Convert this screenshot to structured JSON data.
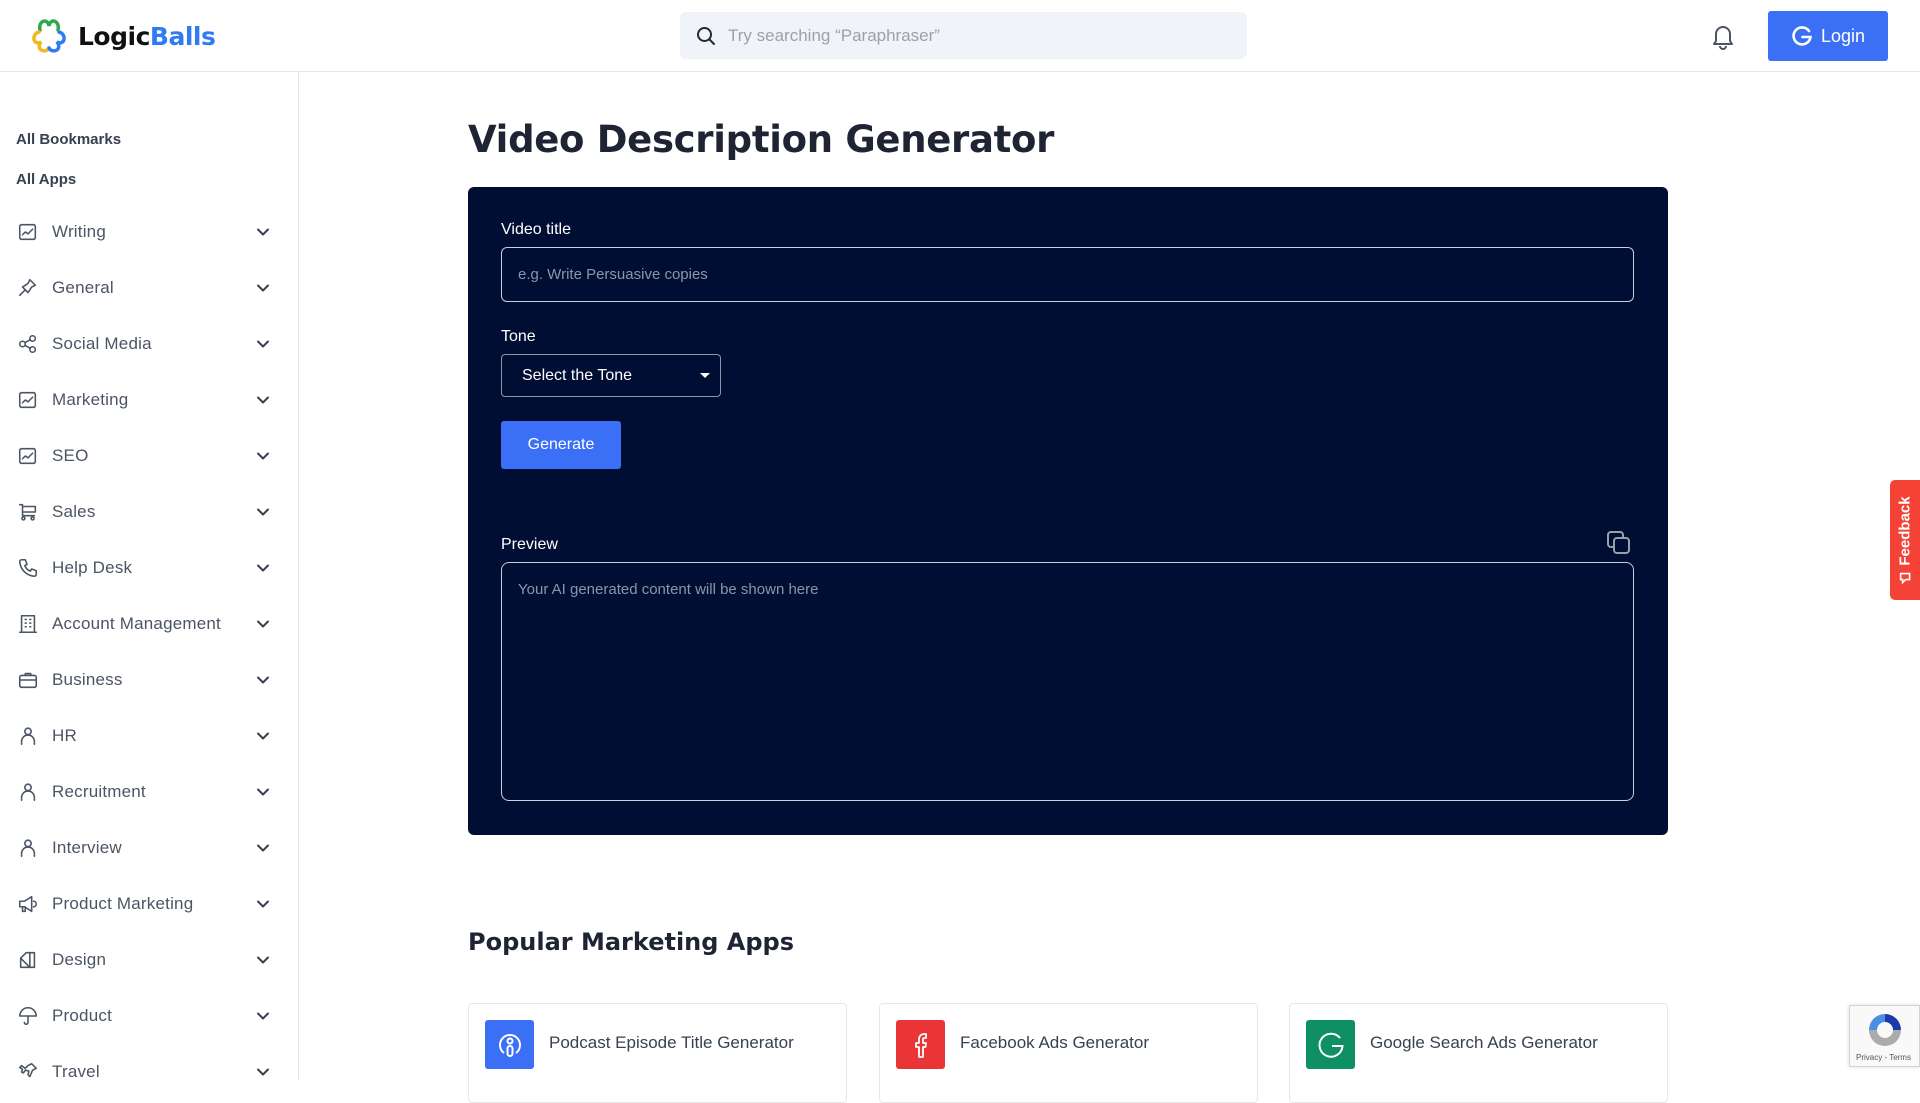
{
  "header": {
    "logo": {
      "part1": "Logic",
      "part2": "Balls",
      "icon": "logicballs-logo-icon"
    },
    "search": {
      "placeholder": "Try searching “Paraphraser”",
      "value": "",
      "icon": "search-icon"
    },
    "notifications_icon": "bell-icon",
    "login": {
      "label": "Login",
      "icon": "google-g-icon"
    }
  },
  "sidebar": {
    "headings": [
      "All Bookmarks",
      "All Apps"
    ],
    "items": [
      {
        "label": "Writing",
        "icon": "chart-box-icon"
      },
      {
        "label": "General",
        "icon": "pin-icon"
      },
      {
        "label": "Social Media",
        "icon": "share-icon"
      },
      {
        "label": "Marketing",
        "icon": "chart-box-icon"
      },
      {
        "label": "SEO",
        "icon": "chart-box-icon"
      },
      {
        "label": "Sales",
        "icon": "cart-icon"
      },
      {
        "label": "Help Desk",
        "icon": "phone-icon"
      },
      {
        "label": "Account Management",
        "icon": "building-icon"
      },
      {
        "label": "Business",
        "icon": "briefcase-icon"
      },
      {
        "label": "HR",
        "icon": "user-icon"
      },
      {
        "label": "Recruitment",
        "icon": "user-icon"
      },
      {
        "label": "Interview",
        "icon": "user-icon"
      },
      {
        "label": "Product Marketing",
        "icon": "megaphone-icon"
      },
      {
        "label": "Design",
        "icon": "design-icon"
      },
      {
        "label": "Product",
        "icon": "umbrella-icon"
      },
      {
        "label": "Travel",
        "icon": "plane-icon"
      }
    ]
  },
  "main": {
    "title": "Video Description Generator",
    "form": {
      "video_title": {
        "label": "Video title",
        "placeholder": "e.g. Write Persuasive copies",
        "value": ""
      },
      "tone": {
        "label": "Tone",
        "selected": "Select the Tone"
      },
      "generate_label": "Generate",
      "preview": {
        "label": "Preview",
        "placeholder": "Your AI generated content will be shown here",
        "copy_icon": "copy-icon"
      }
    },
    "popular": {
      "title": "Popular Marketing Apps",
      "apps": [
        {
          "name": "Podcast Episode Title Generator",
          "icon": "podcast-icon",
          "color": "#3b6ff5"
        },
        {
          "name": "Facebook Ads Generator",
          "icon": "facebook-icon",
          "color": "#ea3536"
        },
        {
          "name": "Google Search Ads Generator",
          "icon": "google-g-icon",
          "color": "#0e8f64"
        }
      ]
    }
  },
  "feedback": {
    "label": "Feedback"
  },
  "recaptcha": {
    "links": "Privacy - Terms"
  },
  "colors": {
    "accent": "#3b6ff5",
    "card_bg": "#010e33",
    "feedback": "#f44336"
  }
}
